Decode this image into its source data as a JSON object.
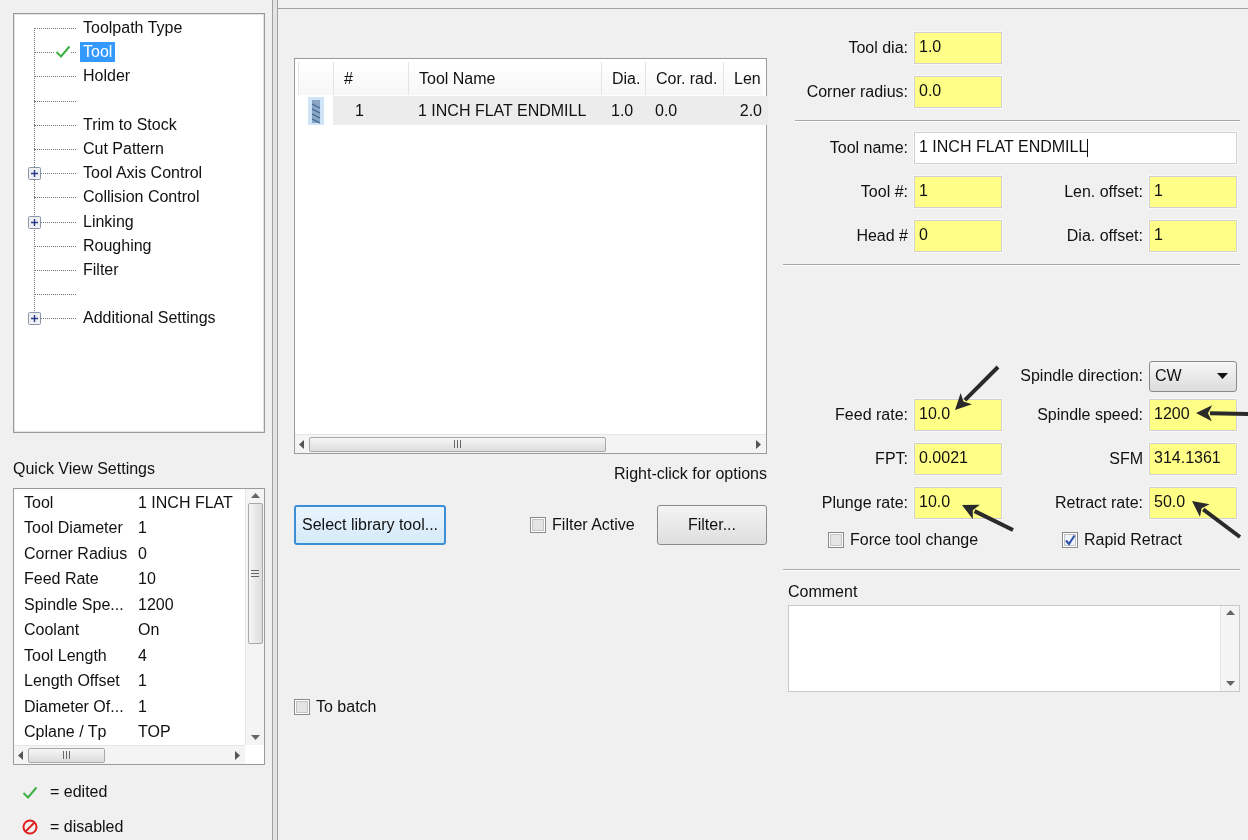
{
  "navigation_tree": [
    {
      "label": "Toolpath Type",
      "kind": "leaf",
      "edited": false,
      "selected": false
    },
    {
      "label": "Tool",
      "kind": "leaf",
      "edited": true,
      "selected": true
    },
    {
      "label": "Holder",
      "kind": "leaf",
      "edited": false,
      "selected": false
    },
    {
      "kind": "blank"
    },
    {
      "label": "Trim to Stock",
      "kind": "leaf",
      "edited": false,
      "selected": false
    },
    {
      "label": "Cut Pattern",
      "kind": "leaf",
      "edited": false,
      "selected": false
    },
    {
      "label": "Tool Axis Control",
      "kind": "group",
      "expanded": false,
      "edited": false,
      "selected": false
    },
    {
      "label": "Collision Control",
      "kind": "leaf",
      "edited": false,
      "selected": false
    },
    {
      "label": "Linking",
      "kind": "group",
      "expanded": false,
      "edited": false,
      "selected": false
    },
    {
      "label": "Roughing",
      "kind": "leaf",
      "edited": false,
      "selected": false
    },
    {
      "label": "Filter",
      "kind": "leaf",
      "edited": false,
      "selected": false
    },
    {
      "kind": "blank"
    },
    {
      "label": "Additional Settings",
      "kind": "group",
      "expanded": false,
      "edited": false,
      "selected": false
    }
  ],
  "quick_view": {
    "title": "Quick View Settings",
    "rows": [
      {
        "name": "Tool",
        "value": "1 INCH FLAT"
      },
      {
        "name": "Tool Diameter",
        "value": "1"
      },
      {
        "name": "Corner Radius",
        "value": "0"
      },
      {
        "name": "Feed Rate",
        "value": "10"
      },
      {
        "name": "Spindle Spe...",
        "value": "1200"
      },
      {
        "name": "Coolant",
        "value": "On"
      },
      {
        "name": "Tool Length",
        "value": "4"
      },
      {
        "name": "Length Offset",
        "value": "1"
      },
      {
        "name": "Diameter Of...",
        "value": "1"
      },
      {
        "name": "Cplane / Tp",
        "value": "TOP"
      }
    ]
  },
  "legend": [
    {
      "kind": "edited",
      "text": "= edited"
    },
    {
      "kind": "disabled",
      "text": "= disabled"
    }
  ],
  "tool_table": {
    "columns": [
      "#",
      "Tool Name",
      "Dia.",
      "Cor. rad.",
      "Len"
    ],
    "rows": [
      {
        "cells": [
          "1",
          "1 INCH FLAT ENDMILL",
          "1.0",
          "0.0",
          "2.0"
        ],
        "selected": true
      }
    ],
    "hint": "Right-click for options"
  },
  "library_button": {
    "label": "Select library tool...",
    "focused": true
  },
  "filter_active": {
    "label": "Filter Active",
    "checked": false
  },
  "filter_button": {
    "label": "Filter..."
  },
  "to_batch": {
    "label": "To batch",
    "checked": false
  },
  "geometry": [
    {
      "left": {
        "label": "Tool dia:",
        "value": "1.0",
        "highlighted": true
      }
    },
    {
      "left": {
        "label": "Corner radius:",
        "value": "0.0",
        "highlighted": true
      }
    }
  ],
  "identity": [
    {
      "left": {
        "label": "Tool name:",
        "value": "1 INCH FLAT ENDMILL",
        "highlighted": false,
        "kind": "wide"
      }
    },
    {
      "left": {
        "label": "Tool #:",
        "value": "1",
        "highlighted": true
      },
      "right": {
        "label": "Len. offset:",
        "value": "1",
        "highlighted": true
      }
    },
    {
      "left": {
        "label": "Head #",
        "value": "0",
        "highlighted": true
      },
      "right": {
        "label": "Dia. offset:",
        "value": "1",
        "highlighted": true
      }
    }
  ],
  "feeds": [
    {
      "right": {
        "label": "Spindle direction:",
        "value": "CW",
        "kind": "dropdown"
      }
    },
    {
      "left": {
        "label": "Feed rate:",
        "value": "10.0",
        "highlighted": true
      },
      "right": {
        "label": "Spindle speed:",
        "value": "1200",
        "highlighted": true
      }
    },
    {
      "left": {
        "label": "FPT:",
        "value": "0.0021",
        "highlighted": true
      },
      "right": {
        "label": "SFM",
        "value": "314.1361",
        "highlighted": true
      }
    },
    {
      "left": {
        "label": "Plunge rate:",
        "value": "10.0",
        "highlighted": true
      },
      "right": {
        "label": "Retract rate:",
        "value": "50.0",
        "highlighted": true
      }
    }
  ],
  "options": [
    {
      "label": "Force tool change",
      "checked": false
    },
    {
      "label": "Rapid Retract",
      "checked": true
    }
  ],
  "comment": {
    "label": "Comment"
  }
}
